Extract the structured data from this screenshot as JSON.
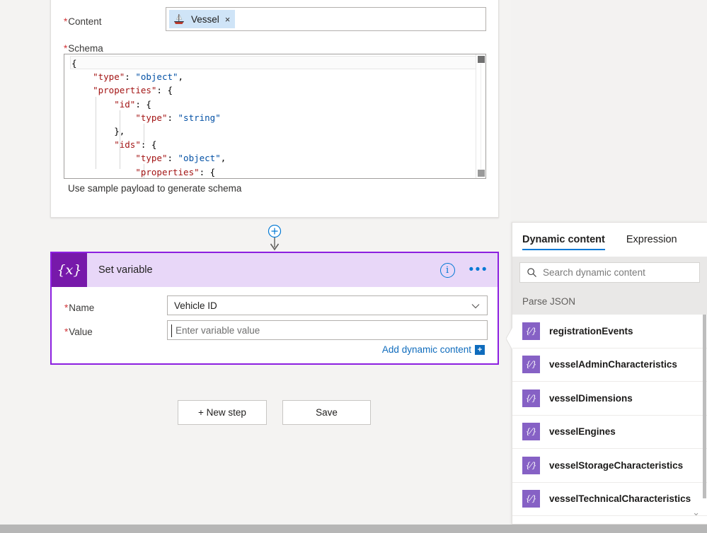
{
  "parse_json_card": {
    "content_label": "Content",
    "required_marker": "*",
    "chip": {
      "label": "Vessel",
      "close": "×",
      "icon": "boat-icon"
    },
    "schema_label": "Schema",
    "schema_code_lines": [
      [
        {
          "t": "{",
          "c": "p"
        }
      ],
      [
        {
          "t": "    ",
          "c": "p"
        },
        {
          "t": "\"type\"",
          "c": "k"
        },
        {
          "t": ": ",
          "c": "p"
        },
        {
          "t": "\"object\"",
          "c": "v"
        },
        {
          "t": ",",
          "c": "p"
        }
      ],
      [
        {
          "t": "    ",
          "c": "p"
        },
        {
          "t": "\"properties\"",
          "c": "k"
        },
        {
          "t": ": {",
          "c": "p"
        }
      ],
      [
        {
          "t": "        ",
          "c": "p"
        },
        {
          "t": "\"id\"",
          "c": "k"
        },
        {
          "t": ": {",
          "c": "p"
        }
      ],
      [
        {
          "t": "            ",
          "c": "p"
        },
        {
          "t": "\"type\"",
          "c": "k"
        },
        {
          "t": ": ",
          "c": "p"
        },
        {
          "t": "\"string\"",
          "c": "v"
        }
      ],
      [
        {
          "t": "        },",
          "c": "p"
        }
      ],
      [
        {
          "t": "        ",
          "c": "p"
        },
        {
          "t": "\"ids\"",
          "c": "k"
        },
        {
          "t": ": {",
          "c": "p"
        }
      ],
      [
        {
          "t": "            ",
          "c": "p"
        },
        {
          "t": "\"type\"",
          "c": "k"
        },
        {
          "t": ": ",
          "c": "p"
        },
        {
          "t": "\"object\"",
          "c": "v"
        },
        {
          "t": ",",
          "c": "p"
        }
      ],
      [
        {
          "t": "            ",
          "c": "p"
        },
        {
          "t": "\"properties\"",
          "c": "k"
        },
        {
          "t": ": {",
          "c": "p"
        }
      ]
    ],
    "sample_payload_link": "Use sample payload to generate schema"
  },
  "set_variable_card": {
    "title": "Set variable",
    "icon": "{x}",
    "info_icon": "i",
    "more_icon": "•••",
    "name_label": "Name",
    "name_value": "Vehicle ID",
    "value_label": "Value",
    "value_placeholder": "Enter variable value",
    "add_dynamic_content": "Add dynamic content",
    "add_dynamic_plus": "+",
    "accent_color": "#7719aa",
    "header_bg": "#e8d7f8"
  },
  "footer": {
    "new_step": "+ New step",
    "save": "Save"
  },
  "dynamic_panel": {
    "tabs": [
      {
        "label": "Dynamic content",
        "active": true
      },
      {
        "label": "Expression",
        "active": false
      }
    ],
    "search_placeholder": "Search dynamic content",
    "search_icon": "search-icon",
    "section_title": "Parse JSON",
    "items": [
      {
        "label": "registrationEvents",
        "icon": "{⁄}"
      },
      {
        "label": "vesselAdminCharacteristics",
        "icon": "{⁄}"
      },
      {
        "label": "vesselDimensions",
        "icon": "{⁄}"
      },
      {
        "label": "vesselEngines",
        "icon": "{⁄}"
      },
      {
        "label": "vesselStorageCharacteristics",
        "icon": "{⁄}"
      },
      {
        "label": "vesselTechnicalCharacteristics",
        "icon": "{⁄}"
      }
    ],
    "item_icon_color": "#8661c5",
    "chevron": "⌄"
  }
}
